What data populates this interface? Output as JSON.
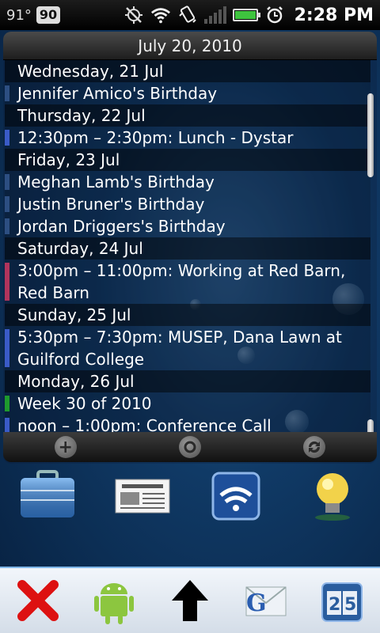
{
  "status_bar": {
    "temperature": "91°",
    "badge": "90",
    "battery_level": 1.0,
    "time": "2:28 PM",
    "icons": [
      "gps-off-icon",
      "wifi-icon",
      "vibrate-icon",
      "signal-icon",
      "battery-icon",
      "alarm-icon"
    ]
  },
  "widget": {
    "header_date": "July 20, 2010",
    "rows": [
      {
        "type": "day",
        "text": "Wednesday, 21 Jul",
        "color": ""
      },
      {
        "type": "event",
        "text": "Jennifer Amico's Birthday",
        "color": "#2d4f82"
      },
      {
        "type": "day",
        "text": "Thursday, 22 Jul",
        "color": ""
      },
      {
        "type": "event",
        "text": "12:30pm – 2:30pm: Lunch - Dystar",
        "color": "#3a5bc7"
      },
      {
        "type": "day",
        "text": "Friday, 23 Jul",
        "color": ""
      },
      {
        "type": "event",
        "text": "Meghan Lamb's Birthday",
        "color": "#2d4f82"
      },
      {
        "type": "event",
        "text": "Justin Bruner's Birthday",
        "color": "#2d4f82"
      },
      {
        "type": "event",
        "text": "Jordan Driggers's Birthday",
        "color": "#2d4f82"
      },
      {
        "type": "day",
        "text": "Saturday, 24 Jul",
        "color": ""
      },
      {
        "type": "event",
        "text": "3:00pm – 11:00pm: Working at Red Barn, Red Barn",
        "color": "#b0345c"
      },
      {
        "type": "day",
        "text": "Sunday, 25 Jul",
        "color": ""
      },
      {
        "type": "event",
        "text": "5:30pm – 7:30pm: MUSEP, Dana Lawn at Guilford College",
        "color": "#3a5bc7"
      },
      {
        "type": "day",
        "text": "Monday, 26 Jul",
        "color": ""
      },
      {
        "type": "event",
        "text": "Week 30 of 2010",
        "color": "#1e9a2e"
      },
      {
        "type": "event",
        "text": "noon – 1:00pm: Conference Call",
        "color": "#3a5bc7"
      }
    ],
    "footer_icons": [
      "add-icon",
      "settings-icon",
      "refresh-icon"
    ]
  },
  "home_apps": [
    "briefcase-icon",
    "news-icon",
    "wifi-app-icon",
    "lightbulb-icon"
  ],
  "dock_icons": [
    "close-x-icon",
    "android-icon",
    "up-arrow-icon",
    "mail-icon",
    "calendar-icon"
  ],
  "calendar_icon_text": "25"
}
